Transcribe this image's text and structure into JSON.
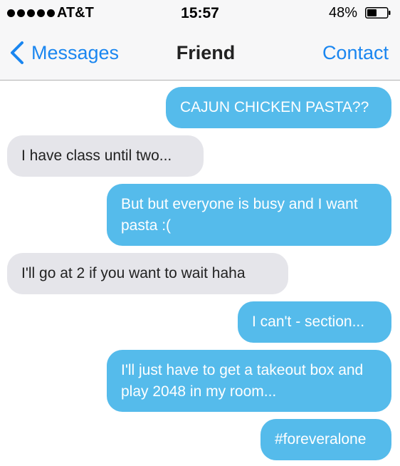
{
  "status_bar": {
    "carrier": "AT&T",
    "time": "15:57",
    "battery_percent": "48%",
    "battery_level": 0.48,
    "signal_bars": 5
  },
  "nav": {
    "back_label": "Messages",
    "title": "Friend",
    "contact_label": "Contact"
  },
  "colors": {
    "accent": "#1a86f0",
    "sent_bubble": "#55bbeb",
    "received_bubble": "#e5e5ea"
  },
  "messages": [
    {
      "direction": "sent",
      "text": "CAJUN CHICKEN PASTA??"
    },
    {
      "direction": "received",
      "text": "I have class until two..."
    },
    {
      "direction": "sent",
      "text": "But but everyone is busy and I want pasta :("
    },
    {
      "direction": "received",
      "text": "I'll go at 2 if you want to wait haha"
    },
    {
      "direction": "sent",
      "text": "I can't - section..."
    },
    {
      "direction": "sent",
      "text": "I'll just have to get a takeout box and play 2048 in my room..."
    },
    {
      "direction": "sent",
      "text": "#foreveralone"
    }
  ]
}
